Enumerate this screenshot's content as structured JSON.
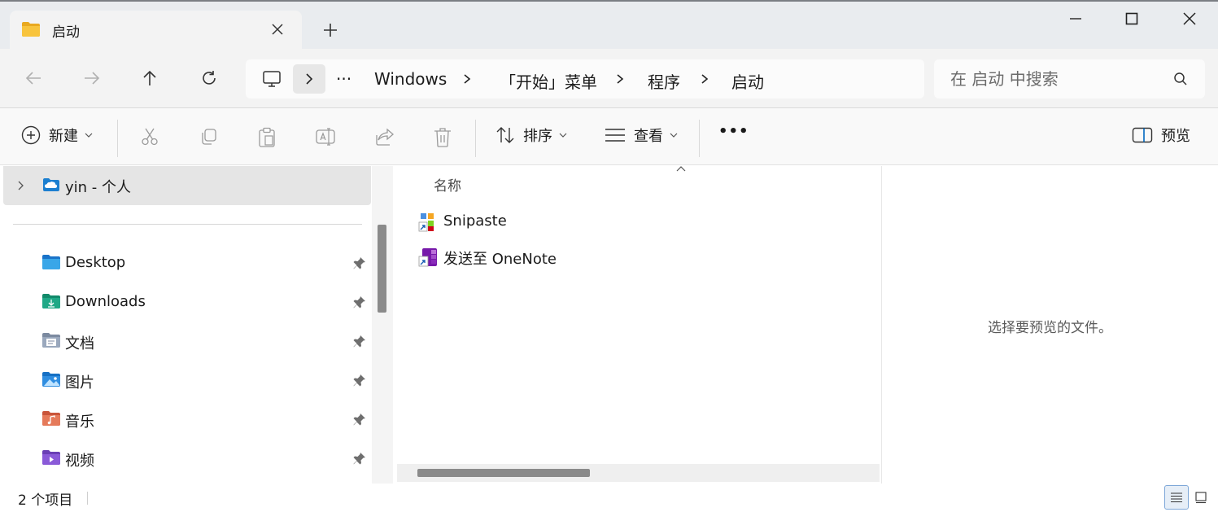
{
  "window": {
    "tab_title": "启动",
    "colors": {
      "titlebar": "#e9ecef",
      "tab": "#f3f3f3",
      "accent": "#0067c0",
      "folder": "#f8c43d"
    }
  },
  "address": {
    "overflow_label": "···",
    "breadcrumbs": [
      "Windows",
      "「开始」菜单",
      "程序",
      "启动"
    ]
  },
  "search": {
    "placeholder": "在 启动 中搜索"
  },
  "toolbar": {
    "new_label": "新建",
    "sort_label": "排序",
    "view_label": "查看",
    "more_label": "•••",
    "preview_label": "预览"
  },
  "nav": {
    "cloud_item": "yin - 个人",
    "items": [
      {
        "label": "Desktop",
        "icon": "desktop-folder-icon"
      },
      {
        "label": "Downloads",
        "icon": "downloads-folder-icon"
      },
      {
        "label": "文档",
        "icon": "documents-folder-icon"
      },
      {
        "label": "图片",
        "icon": "pictures-folder-icon"
      },
      {
        "label": "音乐",
        "icon": "music-folder-icon"
      },
      {
        "label": "视频",
        "icon": "videos-folder-icon"
      }
    ]
  },
  "content": {
    "column_name": "名称",
    "files": [
      {
        "name": "Snipaste",
        "icon": "snipaste-shortcut-icon"
      },
      {
        "name": "发送至 OneNote",
        "icon": "onenote-shortcut-icon"
      }
    ]
  },
  "preview": {
    "message": "选择要预览的文件。"
  },
  "status": {
    "item_count": "2 个项目"
  }
}
